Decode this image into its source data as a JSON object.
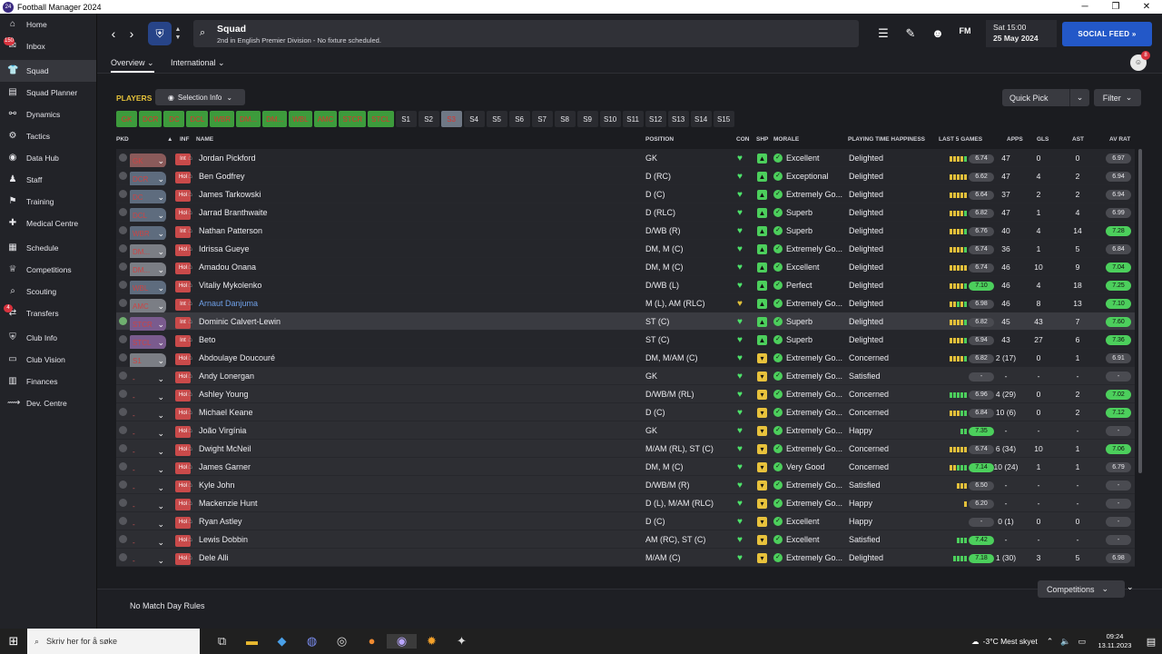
{
  "window": {
    "title": "Football Manager 2024",
    "app_icon_text": "24"
  },
  "sidebar": {
    "items": [
      {
        "label": "Home",
        "icon": "⌂",
        "badge": ""
      },
      {
        "label": "Inbox",
        "icon": "✉",
        "badge": "150"
      },
      {
        "label": "Squad",
        "icon": "👕",
        "badge": ""
      },
      {
        "label": "Squad Planner",
        "icon": "▤",
        "badge": ""
      },
      {
        "label": "Dynamics",
        "icon": "⚯",
        "badge": ""
      },
      {
        "label": "Tactics",
        "icon": "⚙",
        "badge": ""
      },
      {
        "label": "Data Hub",
        "icon": "◉",
        "badge": ""
      },
      {
        "label": "Staff",
        "icon": "♟",
        "badge": ""
      },
      {
        "label": "Training",
        "icon": "⚑",
        "badge": ""
      },
      {
        "label": "Medical Centre",
        "icon": "✚",
        "badge": ""
      },
      {
        "label": "Schedule",
        "icon": "▦",
        "badge": ""
      },
      {
        "label": "Competitions",
        "icon": "♕",
        "badge": ""
      },
      {
        "label": "Scouting",
        "icon": "⌕",
        "badge": ""
      },
      {
        "label": "Transfers",
        "icon": "⇄",
        "badge": "4"
      },
      {
        "label": "Club Info",
        "icon": "⛨",
        "badge": ""
      },
      {
        "label": "Club Vision",
        "icon": "▭",
        "badge": ""
      },
      {
        "label": "Finances",
        "icon": "▥",
        "badge": ""
      },
      {
        "label": "Dev. Centre",
        "icon": "⟿",
        "badge": ""
      }
    ]
  },
  "header": {
    "screen_title": "Squad",
    "screen_subtitle": "2nd in English Premier Division - No fixture scheduled.",
    "fm_label": "FM",
    "date_line1": "Sat 15:00",
    "date_line2": "25 May 2024",
    "social_label": "SOCIAL FEED  »",
    "avatar_badge": "8"
  },
  "subnav": {
    "tab1": "Overview",
    "tab2": "International"
  },
  "toolbar": {
    "players_label": "PLAYERS",
    "selection_info": "Selection Info",
    "quick_pick": "Quick Pick",
    "filter": "Filter"
  },
  "chips": [
    {
      "label": "GK",
      "state": "on"
    },
    {
      "label": "DCR",
      "state": "on"
    },
    {
      "label": "DC",
      "state": "on"
    },
    {
      "label": "DCL",
      "state": "on"
    },
    {
      "label": "WBR",
      "state": "on"
    },
    {
      "label": "DM...",
      "state": "on"
    },
    {
      "label": "DM...",
      "state": "on"
    },
    {
      "label": "WBL",
      "state": "on"
    },
    {
      "label": "AMC",
      "state": "on"
    },
    {
      "label": "STCR",
      "state": "on"
    },
    {
      "label": "STCL",
      "state": "on"
    },
    {
      "label": "S1",
      "state": "off"
    },
    {
      "label": "S2",
      "state": "off"
    },
    {
      "label": "S3",
      "state": "sel"
    },
    {
      "label": "S4",
      "state": "off"
    },
    {
      "label": "S5",
      "state": "off"
    },
    {
      "label": "S6",
      "state": "off"
    },
    {
      "label": "S7",
      "state": "off"
    },
    {
      "label": "S8",
      "state": "off"
    },
    {
      "label": "S9",
      "state": "off"
    },
    {
      "label": "S10",
      "state": "off"
    },
    {
      "label": "S11",
      "state": "off"
    },
    {
      "label": "S12",
      "state": "off"
    },
    {
      "label": "S13",
      "state": "off"
    },
    {
      "label": "S14",
      "state": "off"
    },
    {
      "label": "S15",
      "state": "off"
    }
  ],
  "columns": {
    "pkd": "PKD",
    "inf": "INF",
    "name": "NAME",
    "position": "POSITION",
    "con": "CON",
    "shp": "SHP",
    "morale": "MORALE",
    "pth": "PLAYING TIME HAPPINESS",
    "last5": "LAST 5 GAMES",
    "apps": "APPS",
    "gls": "GLS",
    "ast": "AST",
    "avrat": "AV RAT"
  },
  "players": [
    {
      "pk": "GK",
      "pt": "k",
      "inf": "Int",
      "name": "Jordan Pickford",
      "pos": "GK",
      "con": "g",
      "shp": "g",
      "morale": "Excellent",
      "pth": "Delighted",
      "bars": "yyyyg",
      "l5": "6.74",
      "l5g": false,
      "apps": "47",
      "gls": "0",
      "ast": "0",
      "av": "6.97",
      "avg": false
    },
    {
      "pk": "DCR",
      "pt": "d",
      "inf": "Hol",
      "name": "Ben Godfrey",
      "pos": "D (RC)",
      "con": "g",
      "shp": "g",
      "morale": "Exceptional",
      "pth": "Delighted",
      "bars": "yyyyy",
      "l5": "6.62",
      "l5g": false,
      "apps": "47",
      "gls": "4",
      "ast": "2",
      "av": "6.94",
      "avg": false
    },
    {
      "pk": "DC",
      "pt": "d",
      "inf": "Hol",
      "name": "James Tarkowski",
      "pos": "D (C)",
      "con": "g",
      "shp": "g",
      "morale": "Extremely Go...",
      "pth": "Delighted",
      "bars": "yyyyy",
      "l5": "6.64",
      "l5g": false,
      "apps": "37",
      "gls": "2",
      "ast": "2",
      "av": "6.94",
      "avg": false
    },
    {
      "pk": "DCL",
      "pt": "d",
      "inf": "Hol",
      "name": "Jarrad Branthwaite",
      "pos": "D (RLC)",
      "con": "g",
      "shp": "g",
      "morale": "Superb",
      "pth": "Delighted",
      "bars": "yyyyg",
      "l5": "6.82",
      "l5g": false,
      "apps": "47",
      "gls": "1",
      "ast": "4",
      "av": "6.99",
      "avg": false
    },
    {
      "pk": "WBR",
      "pt": "d",
      "inf": "Int",
      "name": "Nathan Patterson",
      "pos": "D/WB (R)",
      "con": "g",
      "shp": "g",
      "morale": "Superb",
      "pth": "Delighted",
      "bars": "yyyyg",
      "l5": "6.76",
      "l5g": false,
      "apps": "40",
      "gls": "4",
      "ast": "14",
      "av": "7.28",
      "avg": true
    },
    {
      "pk": "DM...",
      "pt": "m",
      "inf": "Hol",
      "name": "Idrissa Gueye",
      "pos": "DM, M (C)",
      "con": "g",
      "shp": "g",
      "morale": "Extremely Go...",
      "pth": "Delighted",
      "bars": "yyyyg",
      "l5": "6.74",
      "l5g": false,
      "apps": "36",
      "gls": "1",
      "ast": "5",
      "av": "6.84",
      "avg": false
    },
    {
      "pk": "DM...",
      "pt": "m",
      "inf": "Hol",
      "name": "Amadou Onana",
      "pos": "DM, M (C)",
      "con": "g",
      "shp": "g",
      "morale": "Excellent",
      "pth": "Delighted",
      "bars": "yyyyy",
      "l5": "6.74",
      "l5g": false,
      "apps": "46",
      "gls": "10",
      "ast": "9",
      "av": "7.04",
      "avg": true
    },
    {
      "pk": "WBL",
      "pt": "d",
      "inf": "Hol",
      "name": "Vitaliy Mykolenko",
      "pos": "D/WB (L)",
      "con": "g",
      "shp": "g",
      "morale": "Perfect",
      "pth": "Delighted",
      "bars": "yyyyg",
      "l5": "7.10",
      "l5g": true,
      "apps": "46",
      "gls": "4",
      "ast": "18",
      "av": "7.25",
      "avg": true
    },
    {
      "pk": "AMC",
      "pt": "m",
      "inf": "Int",
      "name": "Arnaut Danjuma",
      "pos": "M (L), AM (RLC)",
      "con": "y",
      "shp": "g",
      "morale": "Extremely Go...",
      "pth": "Delighted",
      "bars": "yygyg",
      "l5": "6.98",
      "l5g": false,
      "apps": "46",
      "gls": "8",
      "ast": "13",
      "av": "7.10",
      "avg": true,
      "link": true
    },
    {
      "pk": "STCR",
      "pt": "s",
      "inf": "Int",
      "name": "Dominic Calvert-Lewin",
      "pos": "ST (C)",
      "con": "g",
      "shp": "g",
      "morale": "Superb",
      "pth": "Delighted",
      "bars": "yyyyg",
      "l5": "6.82",
      "l5g": false,
      "apps": "45",
      "gls": "43",
      "ast": "7",
      "av": "7.60",
      "avg": true,
      "hl": true,
      "ck": true
    },
    {
      "pk": "STCL",
      "pt": "s",
      "inf": "Int",
      "name": "Beto",
      "pos": "ST (C)",
      "con": "g",
      "shp": "g",
      "morale": "Superb",
      "pth": "Delighted",
      "bars": "yyyyg",
      "l5": "6.94",
      "l5g": false,
      "apps": "43",
      "gls": "27",
      "ast": "6",
      "av": "7.36",
      "avg": true
    },
    {
      "pk": "S1",
      "pt": "m",
      "inf": "Hol",
      "name": "Abdoulaye Doucouré",
      "pos": "DM, M/AM (C)",
      "con": "g",
      "shp": "y",
      "morale": "Extremely Go...",
      "pth": "Concerned",
      "bars": "yyyyg",
      "l5": "6.82",
      "l5g": false,
      "apps": "2 (17)",
      "gls": "0",
      "ast": "1",
      "av": "6.91",
      "avg": false
    },
    {
      "pk": "-",
      "pt": "none",
      "inf": "Hol",
      "name": "Andy Lonergan",
      "pos": "GK",
      "con": "g",
      "shp": "y",
      "morale": "Extremely Go...",
      "pth": "Satisfied",
      "bars": "",
      "l5": "-",
      "l5g": false,
      "apps": "-",
      "gls": "-",
      "ast": "-",
      "av": "-",
      "avg": false,
      "sub": true
    },
    {
      "pk": "-",
      "pt": "none",
      "inf": "Hol",
      "name": "Ashley Young",
      "pos": "D/WB/M (RL)",
      "con": "g",
      "shp": "y",
      "morale": "Extremely Go...",
      "pth": "Concerned",
      "bars": "ggggg",
      "l5": "6.96",
      "l5g": false,
      "apps": "4 (29)",
      "gls": "0",
      "ast": "2",
      "av": "7.02",
      "avg": true,
      "sub": true
    },
    {
      "pk": "-",
      "pt": "none",
      "inf": "Hol",
      "name": "Michael Keane",
      "pos": "D (C)",
      "con": "g",
      "shp": "y",
      "morale": "Extremely Go...",
      "pth": "Concerned",
      "bars": "yyygg",
      "l5": "6.84",
      "l5g": false,
      "apps": "10 (6)",
      "gls": "0",
      "ast": "2",
      "av": "7.12",
      "avg": true,
      "sub": true
    },
    {
      "pk": "-",
      "pt": "none",
      "inf": "Hol",
      "name": "João Virgínia",
      "pos": "GK",
      "con": "g",
      "shp": "y",
      "morale": "Extremely Go...",
      "pth": "Happy",
      "bars": "gg",
      "l5": "7.35",
      "l5g": true,
      "apps": "-",
      "gls": "-",
      "ast": "-",
      "av": "-",
      "avg": false,
      "sub": true
    },
    {
      "pk": "-",
      "pt": "none",
      "inf": "Hol",
      "name": "Dwight McNeil",
      "pos": "M/AM (RL), ST (C)",
      "con": "g",
      "shp": "y",
      "morale": "Extremely Go...",
      "pth": "Concerned",
      "bars": "yyyyy",
      "l5": "6.74",
      "l5g": false,
      "apps": "6 (34)",
      "gls": "10",
      "ast": "1",
      "av": "7.06",
      "avg": true,
      "sub": true
    },
    {
      "pk": "-",
      "pt": "none",
      "inf": "Hol",
      "name": "James Garner",
      "pos": "DM, M (C)",
      "con": "g",
      "shp": "y",
      "morale": "Very Good",
      "pth": "Concerned",
      "bars": "yyggg",
      "l5": "7.14",
      "l5g": true,
      "apps": "10 (24)",
      "gls": "1",
      "ast": "1",
      "av": "6.79",
      "avg": false,
      "sub": true
    },
    {
      "pk": "-",
      "pt": "none",
      "inf": "Hol",
      "name": "Kyle John",
      "pos": "D/WB/M (R)",
      "con": "g",
      "shp": "y",
      "morale": "Extremely Go...",
      "pth": "Satisfied",
      "bars": "yyy",
      "l5": "6.50",
      "l5g": false,
      "apps": "-",
      "gls": "-",
      "ast": "-",
      "av": "-",
      "avg": false,
      "sub": true
    },
    {
      "pk": "-",
      "pt": "none",
      "inf": "Hol",
      "name": "Mackenzie Hunt",
      "pos": "D (L), M/AM (RLC)",
      "con": "g",
      "shp": "y",
      "morale": "Extremely Go...",
      "pth": "Happy",
      "bars": "y",
      "l5": "6.20",
      "l5g": false,
      "apps": "-",
      "gls": "-",
      "ast": "-",
      "av": "-",
      "avg": false,
      "sub": true
    },
    {
      "pk": "-",
      "pt": "none",
      "inf": "Hol",
      "name": "Ryan Astley",
      "pos": "D (C)",
      "con": "g",
      "shp": "y",
      "morale": "Excellent",
      "pth": "Happy",
      "bars": "",
      "l5": "-",
      "l5g": false,
      "apps": "0 (1)",
      "gls": "0",
      "ast": "0",
      "av": "-",
      "avg": false,
      "sub": true
    },
    {
      "pk": "-",
      "pt": "none",
      "inf": "Hol",
      "name": "Lewis Dobbin",
      "pos": "AM (RC), ST (C)",
      "con": "g",
      "shp": "y",
      "morale": "Excellent",
      "pth": "Satisfied",
      "bars": "ggg",
      "l5": "7.42",
      "l5g": true,
      "apps": "-",
      "gls": "-",
      "ast": "-",
      "av": "-",
      "avg": false,
      "sub": true
    },
    {
      "pk": "-",
      "pt": "none",
      "inf": "Hol",
      "name": "Dele Alli",
      "pos": "M/AM (C)",
      "con": "g",
      "shp": "y",
      "morale": "Extremely Go...",
      "pth": "Delighted",
      "bars": "gggg",
      "l5": "7.18",
      "l5g": true,
      "apps": "1 (30)",
      "gls": "3",
      "ast": "5",
      "av": "6.98",
      "avg": false,
      "sub": true
    }
  ],
  "footer": {
    "rules": "No Match Day Rules",
    "competitions": "Competitions"
  },
  "taskbar": {
    "search_placeholder": "Skriv her for å søke",
    "weather": "-3°C  Mest skyet",
    "time": "09:24",
    "date": "13.11.2023"
  }
}
